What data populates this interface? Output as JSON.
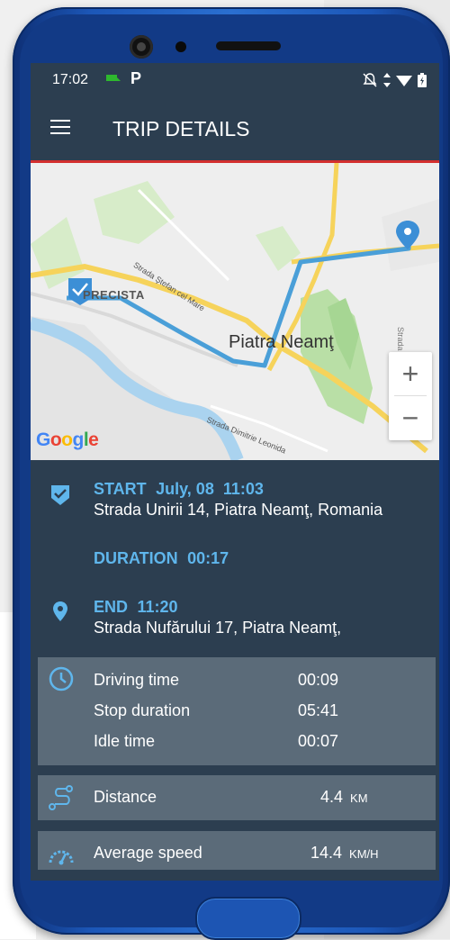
{
  "status_bar": {
    "time": "17:02"
  },
  "app_bar": {
    "title": "TRIP DETAILS"
  },
  "map": {
    "city_label": "Piatra Neamţ",
    "district_label": "PRECISTA",
    "street_labels": [
      "Strada Ştefan cel Mare",
      "Strada Dimitrie Leonida",
      "Strada"
    ],
    "zoom_in": "+",
    "zoom_out": "−",
    "attribution": "Google"
  },
  "trip": {
    "start_label": "START",
    "start_datetime": "July, 08  11:03",
    "start_address": "Strada Unirii 14, Piatra Neamţ, Romania",
    "duration_label": "DURATION",
    "duration_value": "00:17",
    "end_label": "END",
    "end_time": "11:20",
    "end_address": "Strada Nufărului 17, Piatra Neamţ,"
  },
  "times": [
    {
      "label": "Driving time",
      "value": "00:09"
    },
    {
      "label": "Stop duration",
      "value": "05:41"
    },
    {
      "label": "Idle time",
      "value": "00:07"
    }
  ],
  "distance": {
    "label": "Distance",
    "value": "4.4",
    "unit": "KM"
  },
  "speed": {
    "label": "Average speed",
    "value": "14.4",
    "unit": "KM/H"
  },
  "colors": {
    "panel_bg": "#2c3e50",
    "card_bg": "#5b6b79",
    "accent_blue": "#5fb6ec",
    "route_blue": "#4a9fd8",
    "divider_red": "#d32f2f"
  }
}
